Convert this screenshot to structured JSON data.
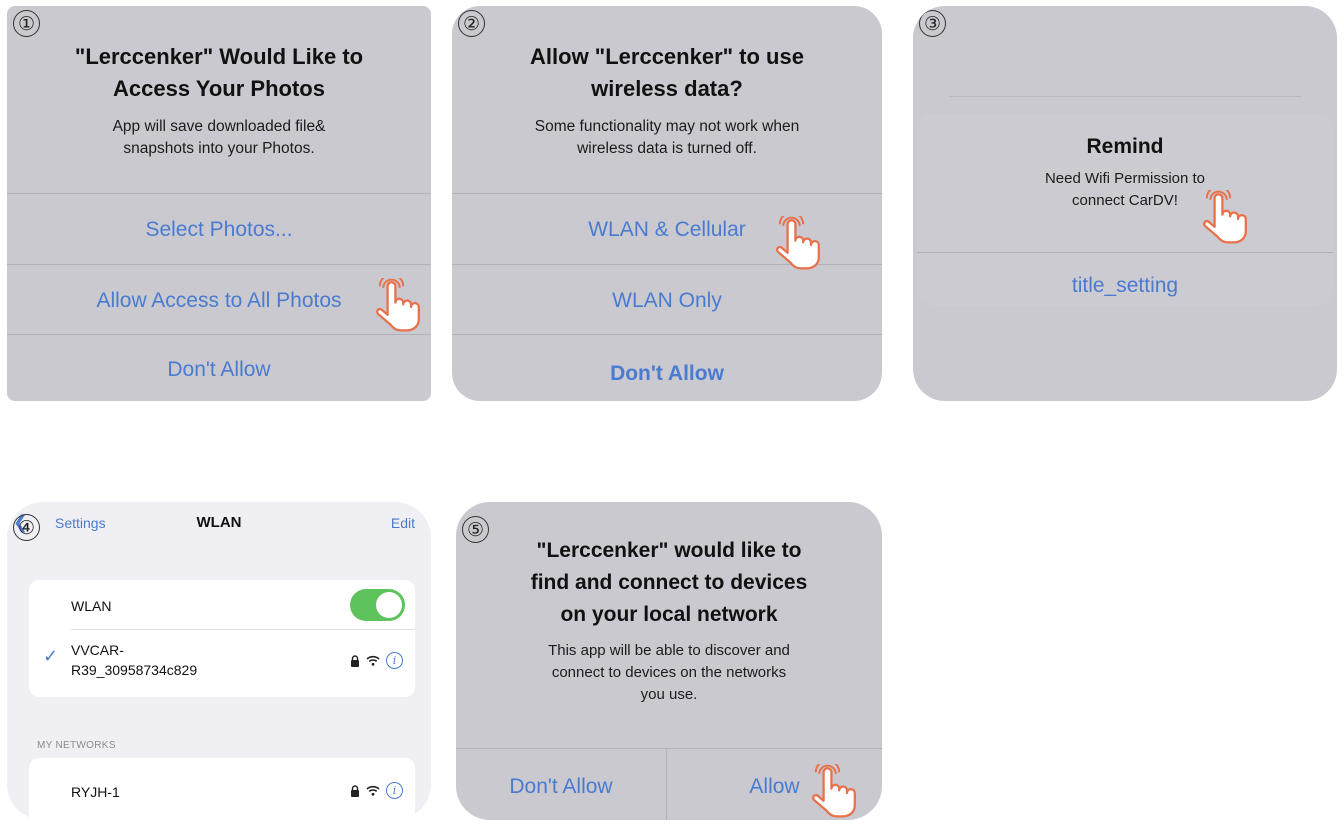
{
  "panels": {
    "p1": {
      "step": "①",
      "title_l1": "\"Lerccenker\" Would Like to",
      "title_l2": "Access Your Photos",
      "msg_l1": "App will save downloaded file&",
      "msg_l2": "snapshots into your Photos.",
      "btn1": "Select Photos...",
      "btn2": "Allow Access to All Photos",
      "btn3": "Don't Allow"
    },
    "p2": {
      "step": "②",
      "title_l1": "Allow \"Lerccenker\" to use",
      "title_l2": "wireless data?",
      "msg_l1": "Some functionality may not work when",
      "msg_l2": "wireless data is turned off.",
      "btn1": "WLAN & Cellular",
      "btn2": "WLAN Only",
      "btn3": "Don't Allow"
    },
    "p3": {
      "step": "③",
      "title": "Remind",
      "msg_l1": "Need Wifi Permission to",
      "msg_l2": "connect CarDV!",
      "btn1": "title_setting"
    },
    "p4": {
      "step": "④",
      "back_label": "Settings",
      "nav_title": "WLAN",
      "edit_label": "Edit",
      "wlan_label": "WLAN",
      "wlan_on": true,
      "connected_l1": "VVCAR-",
      "connected_l2": "R39_30958734c829",
      "section_header": "MY NETWORKS",
      "network1": "RYJH-1",
      "check_glyph": "✓",
      "lock_glyph": "🔒",
      "info_glyph": "i"
    },
    "p5": {
      "step": "⑤",
      "title_l1": "\"Lerccenker\" would like to",
      "title_l2": "find and connect to devices",
      "title_l3": "on your local network",
      "msg_l1": "This app will be able to discover and",
      "msg_l2": "connect to devices on the networks",
      "msg_l3": "you use.",
      "btn_left": "Don't Allow",
      "btn_right": "Allow"
    }
  },
  "colors": {
    "dialog_bg": "#c9c9cf",
    "ios_blue": "#4a7bd0",
    "hand_orange": "#e8704a",
    "toggle_green": "#5ec25d"
  }
}
